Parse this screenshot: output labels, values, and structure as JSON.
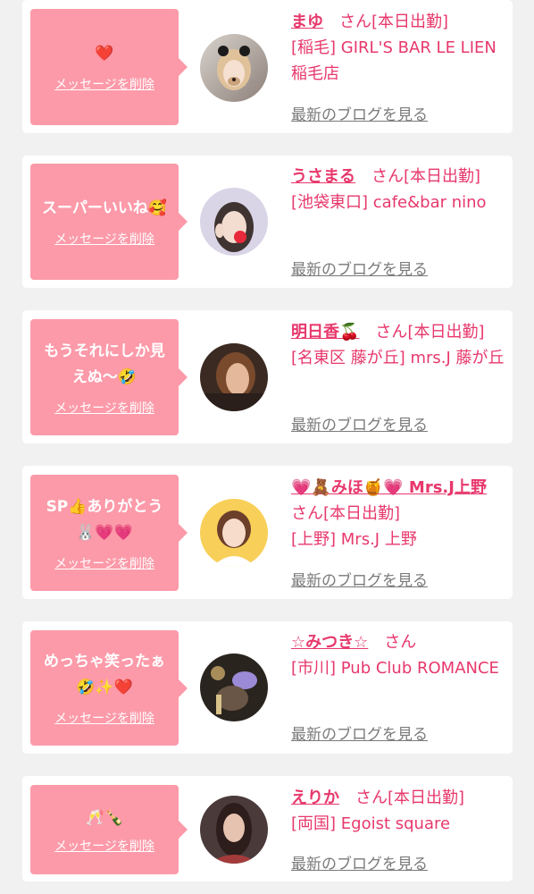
{
  "delete_label": "メッセージを削除",
  "blog_label": "最新のブログを見る",
  "colors": {
    "accent": "#e7386c",
    "bubble": "#fc9aa9",
    "card": "#ffffff",
    "background": "#f1f1f1"
  },
  "cards": [
    {
      "message": "❤️",
      "name": "まゆ",
      "suffix": "　さん[本日出勤]",
      "shop": "[稲毛] GIRL'S BAR LE LIEN 稲毛店"
    },
    {
      "message": "スーパーいいね🥰",
      "name": "うさまる",
      "suffix": "　さん[本日出勤]",
      "shop": "[池袋東口] cafe&bar nino"
    },
    {
      "message": "もうそれにしか見えぬ〜🤣",
      "name": "明日香🍒",
      "suffix": "　さん[本日出勤]",
      "shop": "[名東区 藤が丘] mrs.J 藤が丘"
    },
    {
      "message": "SP👍ありがとう🐰💗💗",
      "name": "💗🧸みほ🍯💗 Mrs.J上野",
      "suffix": "　さん[本日出勤]",
      "shop": "[上野] Mrs.J 上野"
    },
    {
      "message": "めっちゃ笑ったぁ🤣✨❤️",
      "name": "☆みつき☆",
      "suffix": "　さん",
      "shop": "[市川] Pub Club ROMANCE"
    },
    {
      "message": "🥂🍾",
      "name": "えりか",
      "suffix": "　さん[本日出勤]",
      "shop": "[両国] Egoist square"
    }
  ]
}
